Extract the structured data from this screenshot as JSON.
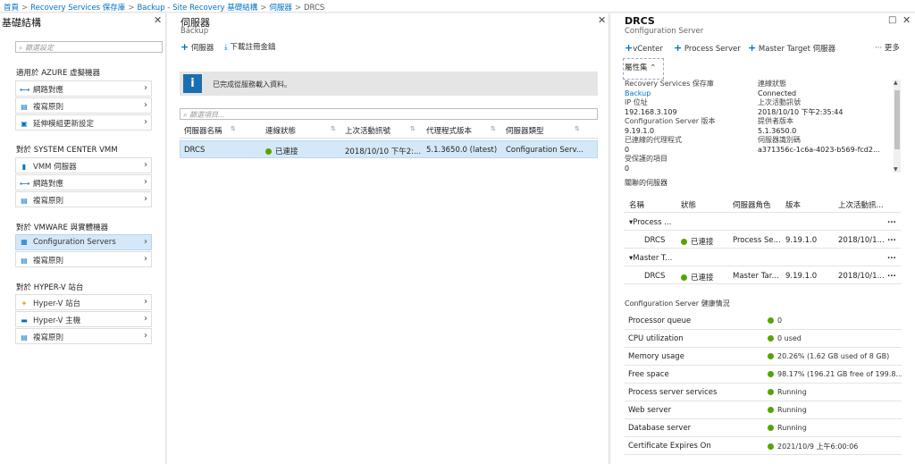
{
  "breadcrumb": {
    "items": [
      "首頁",
      "Recovery Services 保存庫",
      "Backup - Site Recovery 基礎結構",
      "伺服器",
      "DRCS"
    ]
  },
  "left_blade": {
    "title": "基礎結構",
    "search_placeholder": "篩選設定",
    "groups": [
      {
        "label": "適用於 AZURE 虛擬機器",
        "items": [
          {
            "icon": "network-icon",
            "label": "網路對應"
          },
          {
            "icon": "replication-policy-icon",
            "label": "複寫原則"
          },
          {
            "icon": "extension-update-icon",
            "label": "延伸模組更新設定"
          }
        ]
      },
      {
        "label": "對於 SYSTEM CENTER VMM",
        "items": [
          {
            "icon": "vmm-server-icon",
            "label": "VMM 伺服器"
          },
          {
            "icon": "network-icon",
            "label": "網路對應"
          },
          {
            "icon": "replication-policy-icon",
            "label": "複寫原則"
          }
        ]
      },
      {
        "label": "對於 VMWARE 與實體機器",
        "items": [
          {
            "icon": "configuration-server-icon",
            "label": "Configuration Servers"
          },
          {
            "icon": "replication-policy-icon",
            "label": "複寫原則"
          }
        ]
      },
      {
        "label": "對於 HYPER-V 站台",
        "items": [
          {
            "icon": "hyperv-site-icon",
            "label": "Hyper-V 站台"
          },
          {
            "icon": "hyperv-host-icon",
            "label": "Hyper-V 主機"
          },
          {
            "icon": "replication-policy-icon",
            "label": "複寫原則"
          }
        ]
      }
    ]
  },
  "middle_blade": {
    "title": "伺服器",
    "subtitle": "Backup",
    "cmd_server": "伺服器",
    "cmd_download": "下載註冊金鑰",
    "info_text": "已完成從服務載入資料。",
    "search_placeholder": "篩選項目...",
    "columns": [
      "伺服器名稱",
      "連線狀態",
      "上次活動訊號",
      "代理程式版本",
      "伺服器類型"
    ],
    "rows": [
      {
        "name": "DRCS",
        "status": "已連接",
        "heartbeat": "2018/10/10 下午2:...",
        "agent": "5.1.3650.0 (latest)",
        "type": "Configuration Serv..."
      }
    ],
    "more": "..."
  },
  "right_blade": {
    "title": "DRCS",
    "subtitle": "Configuration Server",
    "cmd_vcenter": "vCenter",
    "cmd_process": "Process Server",
    "cmd_master": "Master Target 伺服器",
    "cmd_more": "更多",
    "properties_label": "屬性集",
    "props_left": [
      {
        "k": "Recovery Services 保存庫",
        "v": "Backup"
      },
      {
        "k": "IP 位址",
        "v": "192.168.3.109"
      },
      {
        "k": "Configuration Server 版本",
        "v": "9.19.1.0"
      },
      {
        "k": "已連線的代理程式",
        "v": "0"
      },
      {
        "k": "受保護的項目",
        "v": "0"
      }
    ],
    "props_right": [
      {
        "k": "連線狀態",
        "v": "Connected"
      },
      {
        "k": "上次活動訊號",
        "v": "2018/10/10 下午2:35:44"
      },
      {
        "k": "提供者版本",
        "v": "5.1.3650.0"
      },
      {
        "k": "伺服器識別碼",
        "v": "a371356c-1c6a-4023-b569-fcd2..."
      }
    ],
    "assoc_title": "關聯的伺服器",
    "assoc_columns": [
      "名稱",
      "狀態",
      "伺服器角色",
      "版本",
      "上次活動訊..."
    ],
    "assoc_groups": [
      {
        "label": "Process ...",
        "row": {
          "name": "DRCS",
          "status": "已連接",
          "role": "Process Se...",
          "version": "9.19.1.0",
          "hb": "2018/10/1..."
        }
      },
      {
        "label": "Master T...",
        "row": {
          "name": "DRCS",
          "status": "已連接",
          "role": "Master Tar...",
          "version": "9.19.1.0",
          "hb": "2018/10/1..."
        }
      }
    ],
    "more": "...",
    "health_title": "Configuration Server 健康情況",
    "health": [
      {
        "k": "Processor queue",
        "v": "0"
      },
      {
        "k": "CPU utilization",
        "v": "0 used"
      },
      {
        "k": "Memory usage",
        "v": "20.26% (1.62 GB used of 8 GB)"
      },
      {
        "k": "Free space",
        "v": "98.17% (196.21 GB free of 199.8..."
      },
      {
        "k": "Process server services",
        "v": "Running"
      },
      {
        "k": "Web server",
        "v": "Running"
      },
      {
        "k": "Database server",
        "v": "Running"
      },
      {
        "k": "Certificate Expires On",
        "v": "2021/10/9 上午6:00:06"
      }
    ],
    "ok_color": "#57a300"
  }
}
